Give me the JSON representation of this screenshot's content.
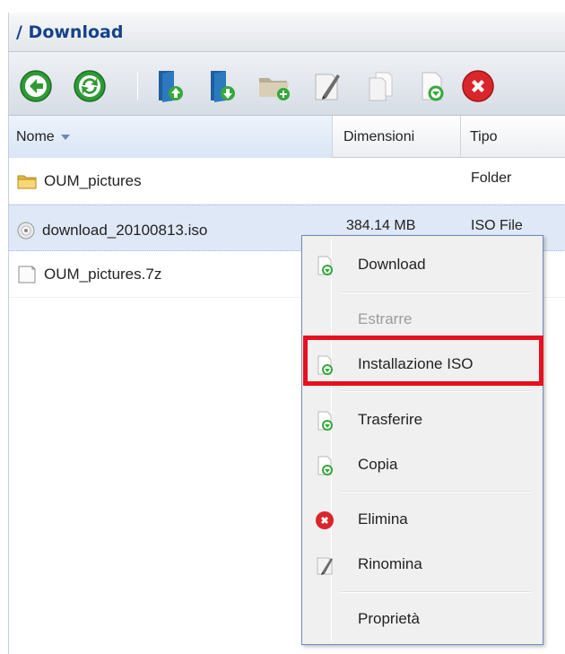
{
  "window": {
    "title": "/ Download"
  },
  "toolbar": {
    "buttons": [
      {
        "icon": "back-icon"
      },
      {
        "icon": "refresh-icon"
      },
      {
        "icon": "upload-icon"
      },
      {
        "icon": "download-icon"
      },
      {
        "icon": "new-folder-icon"
      },
      {
        "icon": "rename-icon"
      },
      {
        "icon": "copy-icon"
      },
      {
        "icon": "file-action-icon"
      },
      {
        "icon": "delete-icon"
      }
    ]
  },
  "columns": {
    "name": "Nome",
    "size": "Dimensioni",
    "type": "Tipo"
  },
  "files": [
    {
      "name": "OUM_pictures",
      "size": "",
      "type": "Folder",
      "icon": "folder-icon"
    },
    {
      "name": "download_20100813.iso",
      "size": "384.14 MB",
      "type": "ISO File",
      "icon": "disc-icon"
    },
    {
      "name": "OUM_pictures.7z",
      "size": "",
      "type": "",
      "icon": "file-icon"
    }
  ],
  "context_menu": {
    "items": {
      "download": "Download",
      "extract": "Estrarre",
      "install_iso": "Installazione ISO",
      "move": "Trasferire",
      "copy": "Copia",
      "delete": "Elimina",
      "rename": "Rinomina",
      "properties": "Proprietà"
    }
  },
  "colors": {
    "accent": "#15428b",
    "selection": "#dfe8f6",
    "highlight": "#e8101e"
  }
}
